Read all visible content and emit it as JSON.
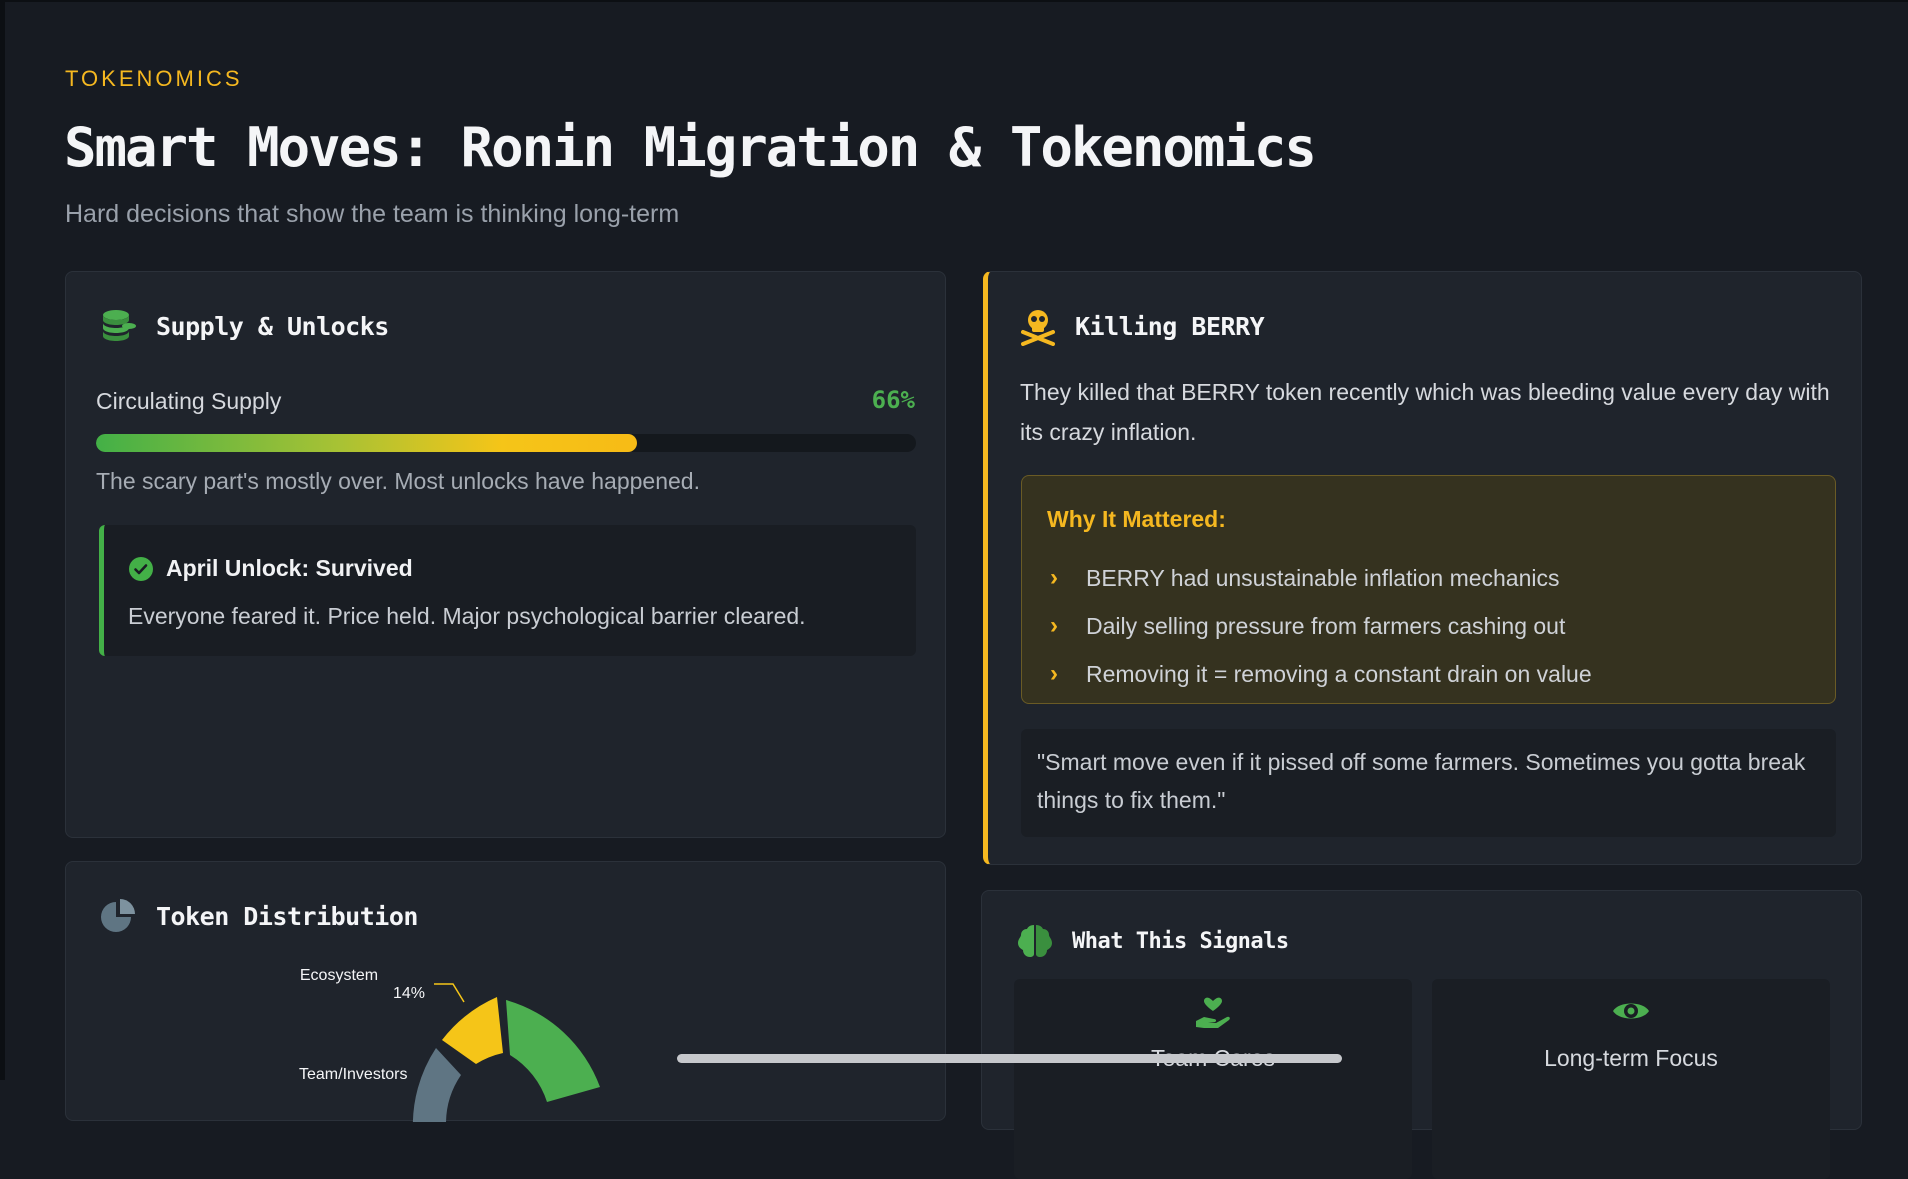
{
  "header": {
    "eyebrow": "TOKENOMICS",
    "title": "Smart Moves: Ronin Migration & Tokenomics",
    "subtitle": "Hard decisions that show the team is thinking long-term"
  },
  "supply": {
    "title": "Supply & Unlocks",
    "icon": "coins-icon",
    "label": "Circulating Supply",
    "percent_text": "66%",
    "percent_value": 66,
    "note": "The scary part's mostly over. Most unlocks have happened.",
    "callout": {
      "icon": "check-circle-icon",
      "title": "April Unlock: Survived",
      "text": "Everyone feared it. Price held. Major psychological barrier cleared."
    }
  },
  "distribution": {
    "title": "Token Distribution",
    "icon": "pie-chart-icon"
  },
  "chart_data": {
    "type": "pie",
    "labels": [
      "Ecosystem",
      "Team/Investors"
    ],
    "visible_labels": [
      {
        "name": "Ecosystem",
        "value_text": "14%"
      },
      {
        "name": "Team/Investors",
        "value_text": ""
      }
    ],
    "slices": [
      {
        "name": "Ecosystem",
        "value": 14,
        "color": "#f5c518"
      },
      {
        "name": "Team/Investors",
        "value": null,
        "color": "#5f7583"
      },
      {
        "name": "",
        "value": null,
        "color": "#4caf50"
      }
    ]
  },
  "berry": {
    "title": "Killing BERRY",
    "icon": "skull-crossbones-icon",
    "text": "They killed that BERRY token recently which was bleeding value every day with its crazy inflation.",
    "why_title": "Why It Mattered:",
    "why_items": [
      "BERRY had unsustainable inflation mechanics",
      "Daily selling pressure from farmers cashing out",
      "Removing it = removing a constant drain on value"
    ],
    "quote": "\"Smart move even if it pissed off some farmers. Sometimes you gotta break things to fix them.\""
  },
  "signals": {
    "title": "What This Signals",
    "icon": "brain-icon",
    "tiles": [
      {
        "label": "Team Cares",
        "icon": "hand-heart-icon"
      },
      {
        "label": "Long-term Focus",
        "icon": "eye-icon"
      }
    ]
  },
  "colors": {
    "accent": "#f5b820",
    "success": "#4caf50",
    "background": "#171b22",
    "card": "#1f242c"
  }
}
